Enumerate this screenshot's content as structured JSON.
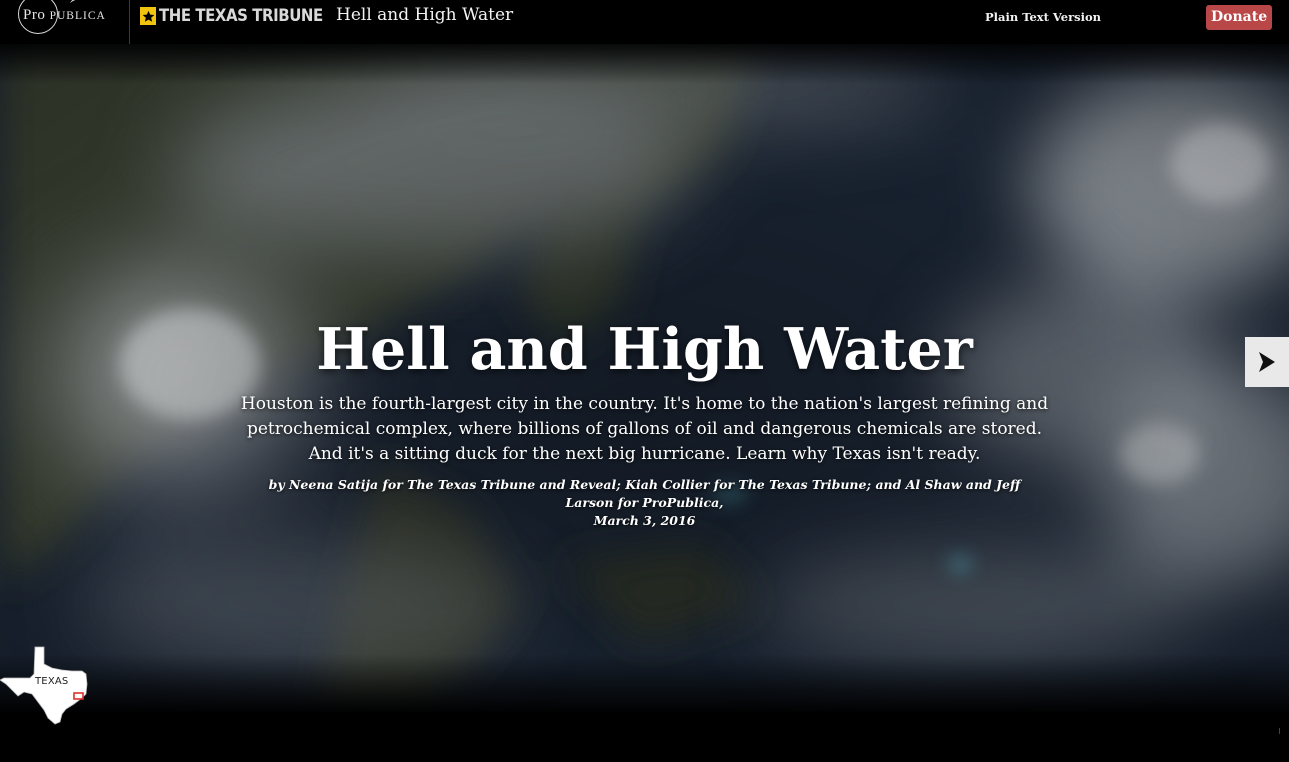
{
  "header": {
    "propublica_logo": {
      "name": "ProPublica",
      "prefix": "Pro",
      "rest": "Publica"
    },
    "texas_tribune_logo": "THE TEXAS TRIBUNE",
    "title": "Hell and High Water",
    "plain_text_link": "Plain Text Version",
    "donate_label": "Donate"
  },
  "hero": {
    "title": "Hell and High Water",
    "dek": "Houston is the fourth-largest city in the country. It's home to the nation's largest refining and petrochemical complex, where billions of gallons of oil and dangerous chemicals are stored. And it's a sitting duck for the next big hurricane. Learn why Texas isn't ready.",
    "byline": "by Neena Satija for The Texas Tribune and Reveal; Kiah Collier for The Texas Tribune; and Al Shaw and Jeff Larson for ProPublica,",
    "date": "March 3, 2016",
    "next_icon": "chevron-right-icon"
  },
  "locator_map": {
    "label": "TEXAS",
    "highlight_color": "#d9342b"
  },
  "colors": {
    "donate_bg": "#b94747",
    "tribune_star": "#f1c40f",
    "background": "#000000"
  }
}
